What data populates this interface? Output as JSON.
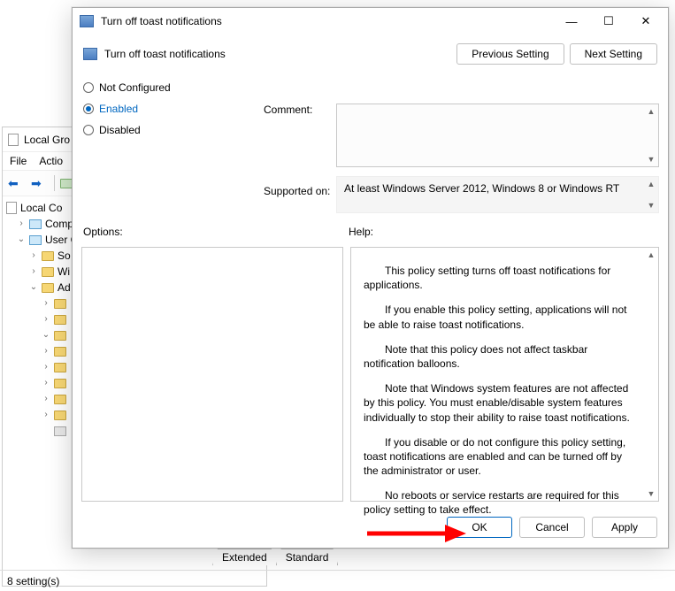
{
  "bg_window": {
    "title": "Local Gro",
    "menu": {
      "file": "File",
      "action": "Actio"
    },
    "tree": {
      "root": "Local Co",
      "computer": "Comp",
      "user": "User C",
      "software": "So",
      "windows": "Wi",
      "admin": "Ad"
    }
  },
  "tabs": {
    "extended": "Extended",
    "standard": "Standard"
  },
  "statusbar": {
    "text": "8 setting(s)"
  },
  "dialog": {
    "title": "Turn off toast notifications",
    "header_title": "Turn off toast notifications",
    "prev": "Previous Setting",
    "next": "Next Setting",
    "radios": {
      "not_configured": "Not Configured",
      "enabled": "Enabled",
      "disabled": "Disabled"
    },
    "labels": {
      "comment": "Comment:",
      "supported": "Supported on:",
      "options": "Options:",
      "help": "Help:"
    },
    "supported_text": "At least Windows Server 2012, Windows 8 or Windows RT",
    "help": {
      "p1": "This policy setting turns off toast notifications for applications.",
      "p2": "If you enable this policy setting, applications will not be able to raise toast notifications.",
      "p3": "Note that this policy does not affect taskbar notification balloons.",
      "p4": "Note that Windows system features are not affected by this policy.  You must enable/disable system features individually to stop their ability to raise toast notifications.",
      "p5": "If you disable or do not configure this policy setting, toast notifications are enabled and can be turned off by the administrator or user.",
      "p6": "No reboots or service restarts are required for this policy setting to take effect."
    },
    "buttons": {
      "ok": "OK",
      "cancel": "Cancel",
      "apply": "Apply"
    },
    "window_controls": {
      "min": "—",
      "max": "☐",
      "close": "✕"
    }
  }
}
